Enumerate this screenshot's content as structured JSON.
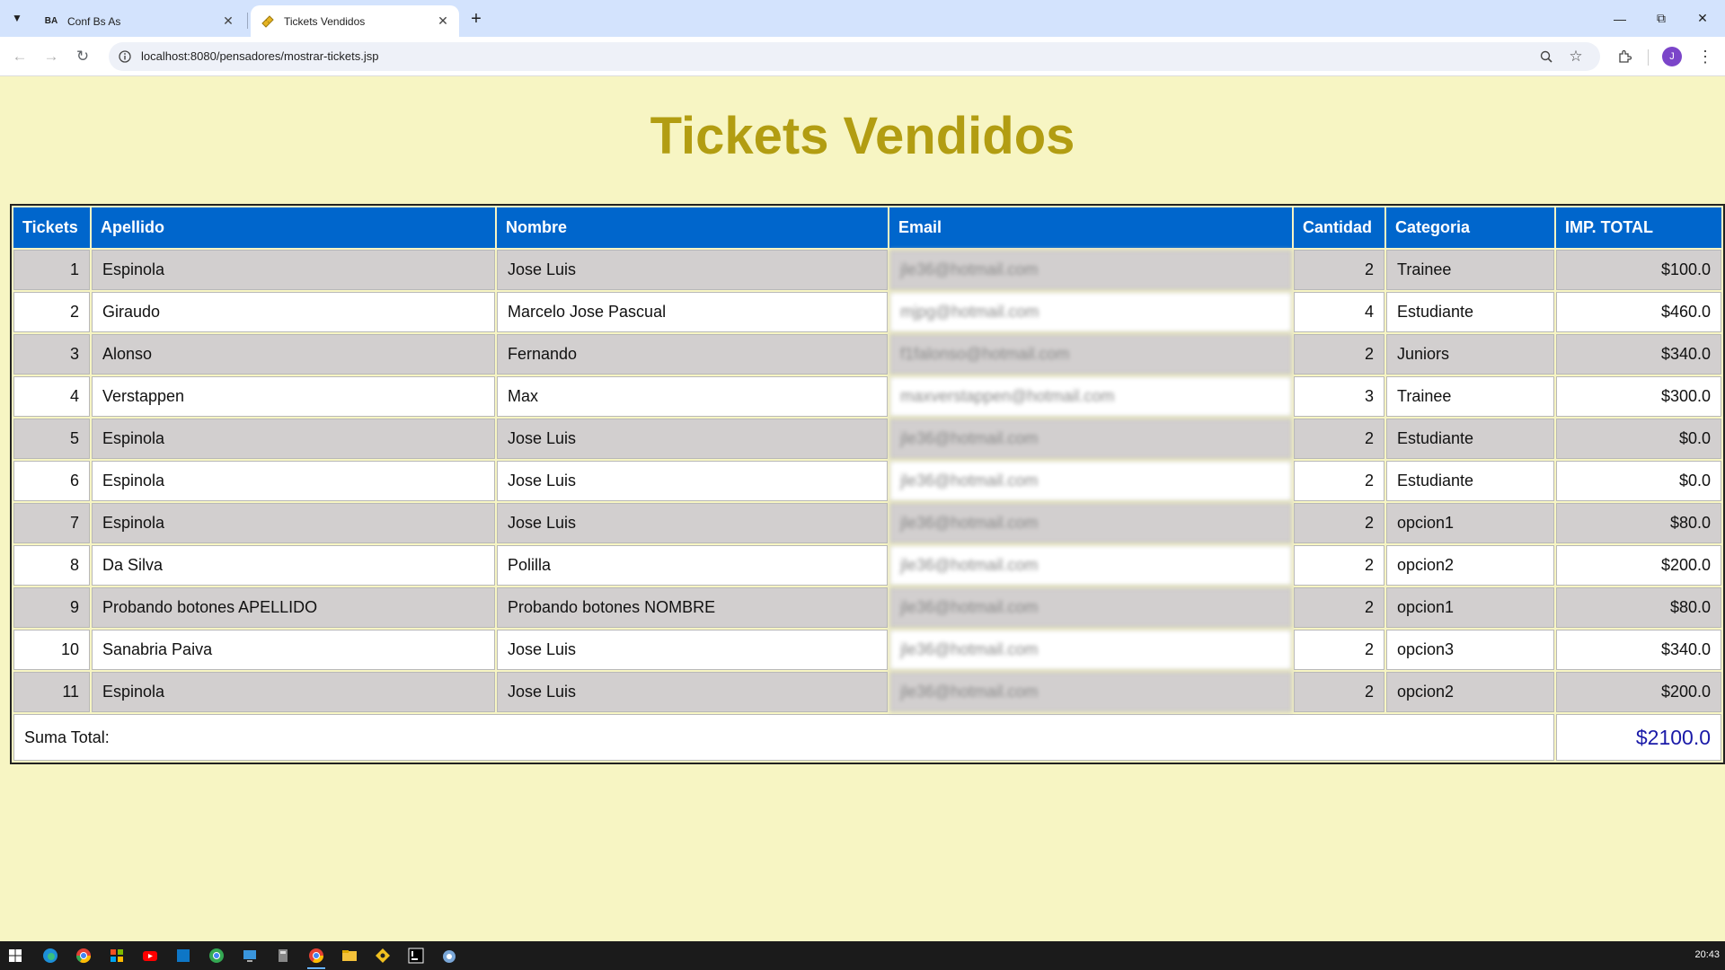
{
  "browser": {
    "tabs": [
      {
        "title": "Conf Bs As",
        "favicon": "BA",
        "active": false
      },
      {
        "title": "Tickets Vendidos",
        "favicon": "ticket-icon",
        "active": true
      }
    ],
    "url": "localhost:8080/pensadores/mostrar-tickets.jsp",
    "profile_initial": "J"
  },
  "page": {
    "title": "Tickets Vendidos",
    "colors": {
      "background": "#f7f5c3",
      "title": "#b29d12",
      "header": "#0066cc",
      "row_odd": "#d2cfcf",
      "total": "#1a1aa8"
    }
  },
  "table": {
    "headers": [
      "Tickets",
      "Apellido",
      "Nombre",
      "Email",
      "Cantidad",
      "Categoria",
      "IMP. TOTAL"
    ],
    "rows": [
      {
        "id": "1",
        "apellido": "Espinola",
        "nombre": "Jose Luis",
        "email": "jle36@hotmail.com",
        "cantidad": "2",
        "categoria": "Trainee",
        "total": "$100.0"
      },
      {
        "id": "2",
        "apellido": "Giraudo",
        "nombre": "Marcelo Jose Pascual",
        "email": "mjpg@hotmail.com",
        "cantidad": "4",
        "categoria": "Estudiante",
        "total": "$460.0"
      },
      {
        "id": "3",
        "apellido": "Alonso",
        "nombre": "Fernando",
        "email": "f1falonso@hotmail.com",
        "cantidad": "2",
        "categoria": "Juniors",
        "total": "$340.0"
      },
      {
        "id": "4",
        "apellido": "Verstappen",
        "nombre": "Max",
        "email": "maxverstappen@hotmail.com",
        "cantidad": "3",
        "categoria": "Trainee",
        "total": "$300.0"
      },
      {
        "id": "5",
        "apellido": "Espinola",
        "nombre": "Jose Luis",
        "email": "jle36@hotmail.com",
        "cantidad": "2",
        "categoria": "Estudiante",
        "total": "$0.0"
      },
      {
        "id": "6",
        "apellido": "Espinola",
        "nombre": "Jose Luis",
        "email": "jle36@hotmail.com",
        "cantidad": "2",
        "categoria": "Estudiante",
        "total": "$0.0"
      },
      {
        "id": "7",
        "apellido": "Espinola",
        "nombre": "Jose Luis",
        "email": "jle36@hotmail.com",
        "cantidad": "2",
        "categoria": "opcion1",
        "total": "$80.0"
      },
      {
        "id": "8",
        "apellido": "Da Silva",
        "nombre": "Polilla",
        "email": "jle36@hotmail.com",
        "cantidad": "2",
        "categoria": "opcion2",
        "total": "$200.0"
      },
      {
        "id": "9",
        "apellido": "Probando botones APELLIDO",
        "nombre": "Probando botones NOMBRE",
        "email": "jle36@hotmail.com",
        "cantidad": "2",
        "categoria": "opcion1",
        "total": "$80.0"
      },
      {
        "id": "10",
        "apellido": "Sanabria Paiva",
        "nombre": "Jose Luis",
        "email": "jle36@hotmail.com",
        "cantidad": "2",
        "categoria": "opcion3",
        "total": "$340.0"
      },
      {
        "id": "11",
        "apellido": "Espinola",
        "nombre": "Jose Luis",
        "email": "jle36@hotmail.com",
        "cantidad": "2",
        "categoria": "opcion2",
        "total": "$200.0"
      }
    ],
    "footer_label": "Suma Total:",
    "footer_total": "$2100.0"
  },
  "taskbar": {
    "apps": [
      "windows-start-icon",
      "edge-icon",
      "chrome-icon",
      "office-icon",
      "youtube-icon",
      "vscode-icon",
      "chrome-icon",
      "remote-desktop-icon",
      "calculator-icon",
      "chrome-active-icon",
      "file-explorer-icon",
      "git-icon",
      "intellij-icon",
      "app-icon"
    ],
    "clock": "20:43"
  }
}
